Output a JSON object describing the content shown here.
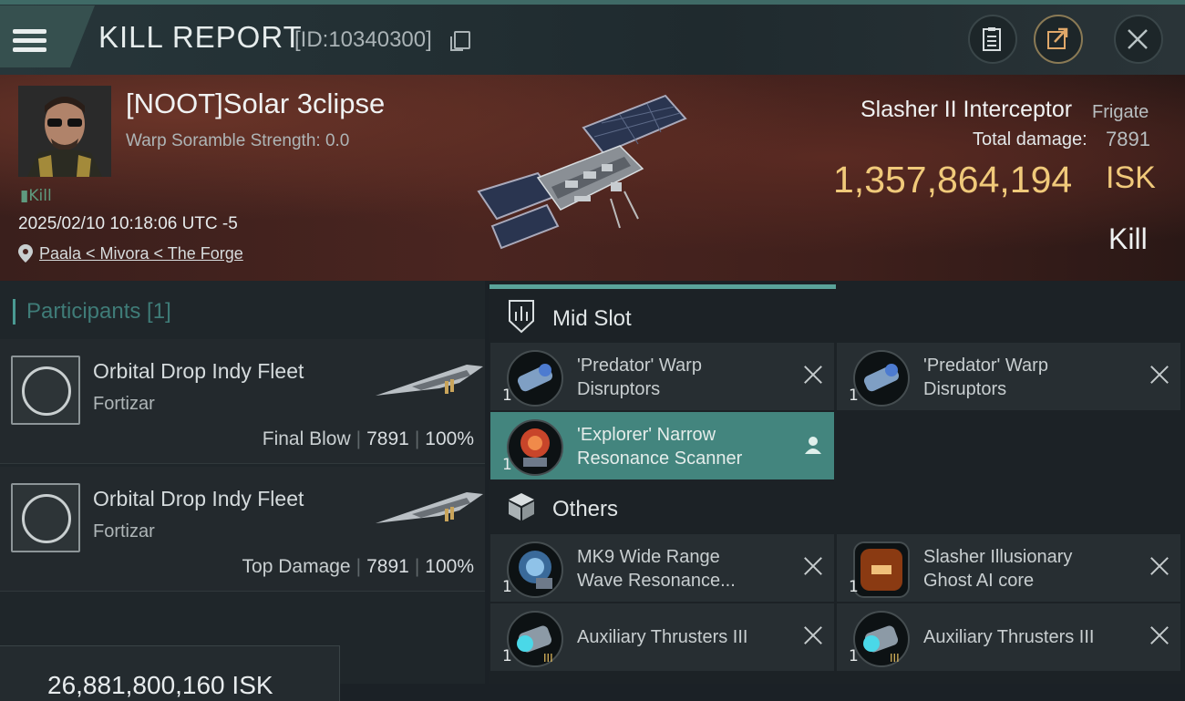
{
  "header": {
    "title": "KILL REPORT",
    "report_id": "[ID:10340300]",
    "icons": [
      "menu-icon",
      "copy-icon",
      "clipboard-icon",
      "share-icon",
      "close-icon"
    ]
  },
  "victim": {
    "name": "[NOOT]Solar 3clipse",
    "warp_scramble": "Warp Soramble Strength: 0.0",
    "tag": "Kill",
    "datetime": "2025/02/10 10:18:06 UTC -5",
    "location": "Paala < Mivora < The Forge",
    "ship_name": "Slasher II Interceptor",
    "ship_class": "Frigate",
    "total_damage_label": "Total damage:",
    "total_damage": "7891",
    "isk_value": "1,357,864,194",
    "isk_label": "ISK",
    "result": "Kill"
  },
  "participants": {
    "heading": "Participants [1]",
    "rows": [
      {
        "fleet": "Orbital Drop Indy Fleet",
        "ship": "Fortizar",
        "role": "Final Blow",
        "damage": "7891",
        "percent": "100%"
      },
      {
        "fleet": "Orbital Drop Indy Fleet",
        "ship": "Fortizar",
        "role": "Top Damage",
        "damage": "7891",
        "percent": "100%"
      }
    ],
    "footer_value": "26,881,800,160 ISK"
  },
  "slots": {
    "mid_label": "Mid Slot",
    "others_label": "Others",
    "mid": [
      {
        "qty": "1",
        "name_line1": "'Predator' Warp",
        "name_line2": "Disruptors"
      },
      {
        "qty": "1",
        "name_line1": "'Predator' Warp",
        "name_line2": "Disruptors"
      },
      {
        "qty": "1",
        "name_line1": "'Explorer' Narrow",
        "name_line2": "Resonance Scanner"
      }
    ],
    "others": [
      {
        "qty": "1",
        "name_line1": "MK9 Wide Range",
        "name_line2": "Wave Resonance..."
      },
      {
        "qty": "1",
        "name_line1": "Slasher Illusionary",
        "name_line2": "Ghost AI core"
      },
      {
        "qty": "1",
        "name_line1": "Auxiliary Thrusters III",
        "name_line2": ""
      },
      {
        "qty": "1",
        "name_line1": "Auxiliary Thrusters III",
        "name_line2": ""
      }
    ]
  },
  "colors": {
    "accent": "#4a9a93",
    "selected_row": "#43857e",
    "isk_gold": "#f0c97a",
    "background": "#1b2126"
  }
}
